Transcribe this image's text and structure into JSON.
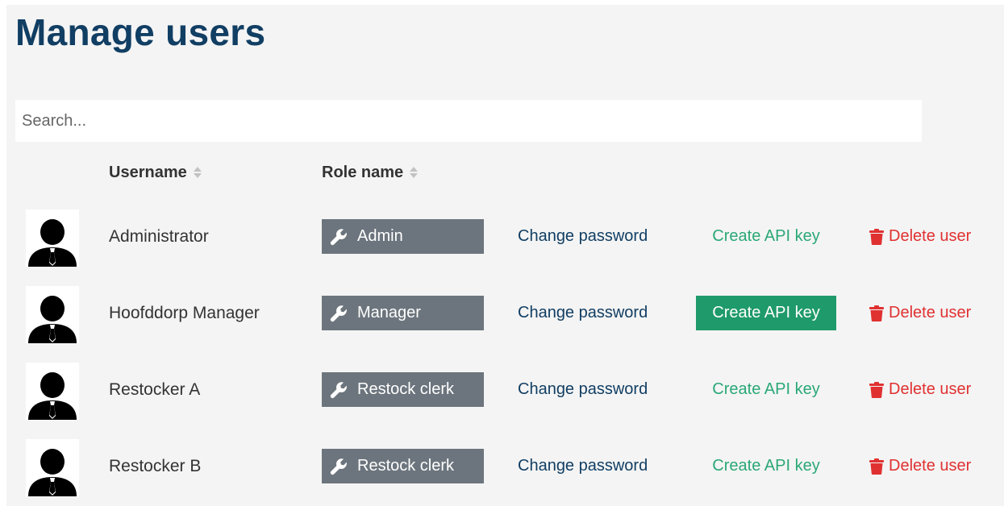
{
  "page": {
    "title": "Manage users"
  },
  "search": {
    "placeholder": "Search..."
  },
  "table": {
    "columns": {
      "username": "Username",
      "role": "Role name"
    },
    "rows": [
      {
        "username": "Administrator",
        "role": "Admin",
        "change_password": "Change password",
        "create_api_key": "Create API key",
        "delete_user": "Delete user",
        "api_key_highlighted": false
      },
      {
        "username": "Hoofddorp Manager",
        "role": "Manager",
        "change_password": "Change password",
        "create_api_key": "Create API key",
        "delete_user": "Delete user",
        "api_key_highlighted": true
      },
      {
        "username": "Restocker A",
        "role": "Restock clerk",
        "change_password": "Change password",
        "create_api_key": "Create API key",
        "delete_user": "Delete user",
        "api_key_highlighted": false
      },
      {
        "username": "Restocker B",
        "role": "Restock clerk",
        "change_password": "Change password",
        "create_api_key": "Create API key",
        "delete_user": "Delete user",
        "api_key_highlighted": false
      }
    ]
  },
  "icons": {
    "avatar": "user-avatar-icon",
    "sort": "sort-icon",
    "role": "wrench-icon",
    "delete": "trash-icon"
  },
  "colors": {
    "title": "#113e63",
    "role_badge": "#6c757d",
    "change_password": "#113e63",
    "create_api_key": "#2aa876",
    "create_api_key_active_bg": "#1f9a6a",
    "delete_user": "#e03131",
    "panel_background": "#f4f4f4"
  }
}
